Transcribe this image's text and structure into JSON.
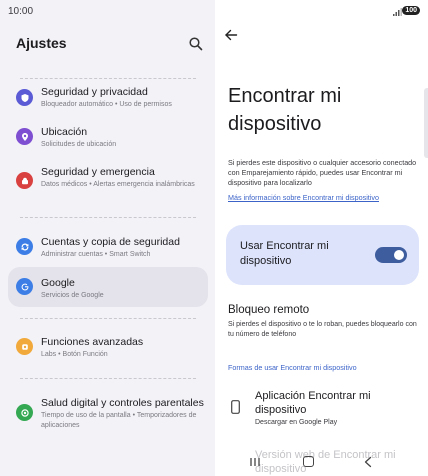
{
  "status": {
    "time": "10:00",
    "battery": "100"
  },
  "settings": {
    "title": "Ajustes",
    "items": [
      {
        "title": "Seguridad y privacidad",
        "subtitle": "Bloqueador automático • Uso de permisos",
        "icon": "shield-icon",
        "color": "#5b5bd6"
      },
      {
        "title": "Ubicación",
        "subtitle": "Solicitudes de ubicación",
        "icon": "location-pin-icon",
        "color": "#7e4fd1"
      },
      {
        "title": "Seguridad y emergencia",
        "subtitle": "Datos médicos • Alertas emergencia inalámbricas",
        "icon": "emergency-icon",
        "color": "#d94141"
      },
      {
        "title": "Cuentas y copia de seguridad",
        "subtitle": "Administrar cuentas • Smart Switch",
        "icon": "sync-icon",
        "color": "#3d7ee6"
      },
      {
        "title": "Google",
        "subtitle": "Servicios de Google",
        "icon": "google-icon",
        "color": "#3d7ee6"
      },
      {
        "title": "Funciones avanzadas",
        "subtitle": "Labs • Botón Función",
        "icon": "star-icon",
        "color": "#f2a93b"
      },
      {
        "title": "Salud digital y controles parentales",
        "subtitle": "Tiempo de uso de la pantalla • Temporizadores de aplicaciones",
        "icon": "wellbeing-icon",
        "color": "#34a853"
      }
    ]
  },
  "detail": {
    "title": "Encontrar mi dispositivo",
    "description": "Si pierdes este dispositivo o cualquier accesorio conectado con Emparejamiento rápido, puedes usar Encontrar mi dispositivo para localizarlo",
    "more_info_link": "Más información sobre Encontrar mi dispositivo",
    "toggle_label": "Usar Encontrar mi dispositivo",
    "toggle_on": true,
    "remote_lock_title": "Bloqueo remoto",
    "remote_lock_desc": "Si pierdes el dispositivo o te lo roban, puedes bloquearlo con tu número de teléfono",
    "section_link": "Formas de usar Encontrar mi dispositivo",
    "app_title": "Aplicación Encontrar mi dispositivo",
    "app_subtitle": "Descargar en Google Play",
    "web_title": "Versión web de Encontrar mi dispositivo",
    "accent": "#3e5d9e",
    "card_bg": "#dce3fb"
  }
}
